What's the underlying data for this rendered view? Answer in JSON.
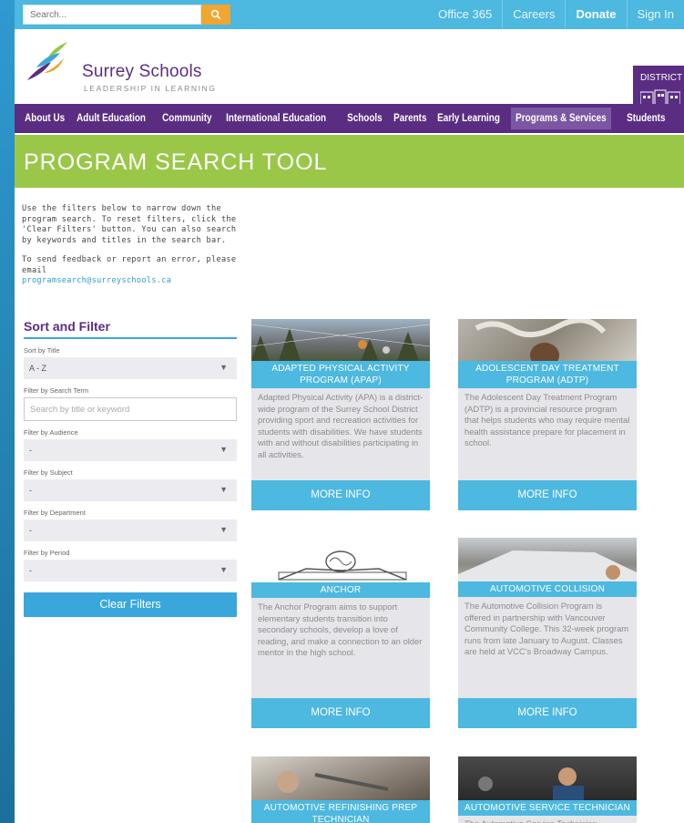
{
  "topbar": {
    "search_placeholder": "Search...",
    "links": [
      "Office 365",
      "Careers",
      "Donate",
      "Sign In"
    ]
  },
  "header": {
    "logo_title": "Surrey Schools",
    "logo_subtitle": "LEADERSHIP IN LEARNING",
    "district_label": "DISTRICT"
  },
  "nav": {
    "items": [
      "About Us",
      "Adult Education",
      "Community",
      "International Education",
      "Schools",
      "Parents",
      "Early Learning",
      "Programs & Services",
      "Students"
    ],
    "active": "Programs & Services"
  },
  "banner": {
    "title": "PROGRAM SEARCH TOOL"
  },
  "intro": {
    "para1": "Use the filters below to narrow down the program search. To reset filters, click the 'Clear Filters' button. You can also search by keywords and titles in the search bar.",
    "para2": "To send feedback or report an error, please email",
    "email": "programsearch@surreyschools.ca"
  },
  "filters": {
    "title": "Sort and Filter",
    "sort_label": "Sort by Title",
    "sort_value": "A - Z",
    "search_label": "Filter by Search Term",
    "search_placeholder": "Search by title or keyword",
    "audience_label": "Filter by Audience",
    "audience_value": "-",
    "subject_label": "Filter by Subject",
    "subject_value": "-",
    "department_label": "Filter by Department",
    "department_value": "-",
    "period_label": "Filter by Period",
    "period_value": "-",
    "clear_label": "Clear Filters"
  },
  "cards": [
    {
      "title": "ADAPTED PHYSICAL ACTIVITY PROGRAM (APAP)",
      "desc": "Adapted Physical Activity (APA) is a district-wide program of the Surrey School District providing sport and recreation activities for students with disabilities. We have students with and without disabilities participating in all activities.",
      "more": "MORE INFO"
    },
    {
      "title": "ADOLESCENT DAY TREATMENT PROGRAM (ADTP)",
      "desc": "The Adolescent Day Treatment Program (ADTP) is a provincial resource program that helps students who may require mental health assistance prepare for placement in school.",
      "more": "MORE INFO"
    },
    {
      "title": "ANCHOR",
      "desc": "The Anchor Program aims to support elementary students transition into secondary schools, develop a love of reading, and make a connection to an older mentor in the high school.",
      "more": "MORE INFO"
    },
    {
      "title": "AUTOMOTIVE COLLISION",
      "desc": "The Automotive Collision Program is offered in partnership with Vancouver Community College. This 32-week program runs from late January to August. Classes are held at VCC's Broadway Campus.",
      "more": "MORE INFO"
    },
    {
      "title": "AUTOMOTIVE REFINISHING PREP TECHNICIAN",
      "desc": "",
      "more": ""
    },
    {
      "title": "AUTOMOTIVE SERVICE TECHNICIAN",
      "desc": "The Automotive Service Technician",
      "more": ""
    }
  ],
  "colors": {
    "topbar": "#4db8e0",
    "nav": "#5a2d82",
    "banner": "#9ac748",
    "accent": "#3aa7dc",
    "search_button": "#f0a630"
  }
}
